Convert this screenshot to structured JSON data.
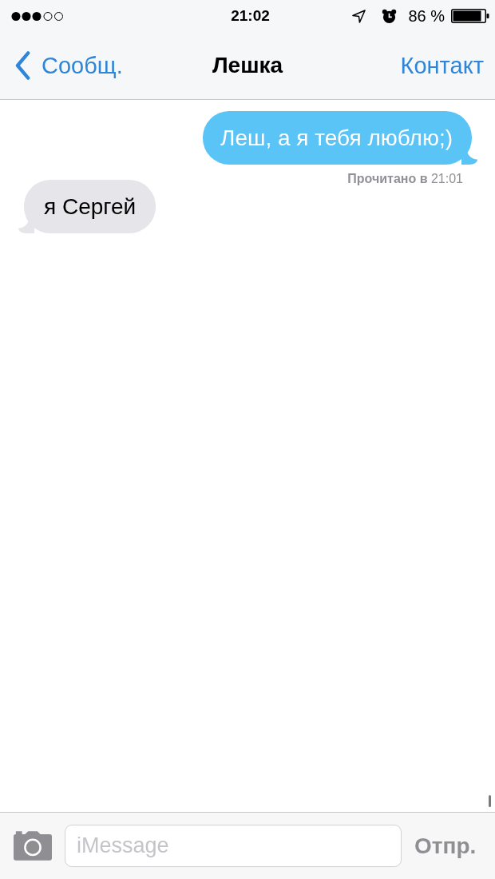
{
  "status_bar": {
    "time": "21:02",
    "battery": "86 %"
  },
  "nav_bar": {
    "back": "Сообщ.",
    "title": "Лешка",
    "action": "Контакт"
  },
  "messages": [
    {
      "kind": "outgoing",
      "text": "Леш, а я тебя люблю;)",
      "receipt": "**Прочитано в** 21:01"
    },
    {
      "kind": "incoming",
      "text": "я Сергей"
    }
  ],
  "composer": {
    "placeholder": "iMessage",
    "send": {
      "label": "Отпр.",
      "disabled": true
    }
  }
}
